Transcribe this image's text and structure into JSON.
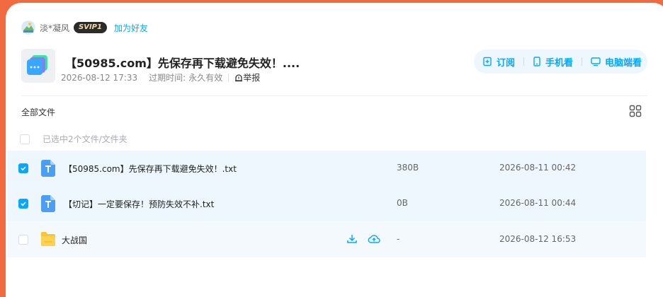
{
  "user": {
    "name": "淡*凝风",
    "vip_badge": "SVIP1",
    "add_friend": "加为好友"
  },
  "share": {
    "title": "【50985.com】先保存再下载避免失效！....",
    "date": "2026-08-12 17:33",
    "expire_label": "过期时间:",
    "expire_value": "永久有效",
    "report": "举报"
  },
  "actions": {
    "subscribe": "订阅",
    "mobile": "手机看",
    "pc": "电脑端看"
  },
  "nav": {
    "all_files": "全部文件"
  },
  "selection": {
    "text": "已选中2个文件/文件夹"
  },
  "files": [
    {
      "name": "【50985.com】先保存再下载避免失效！.txt",
      "size": "380B",
      "date": "2026-08-11 00:42",
      "type": "txt",
      "checked": true
    },
    {
      "name": "【切记】一定要保存！预防失效不补.txt",
      "size": "0B",
      "date": "2026-08-11 00:44",
      "type": "txt",
      "checked": true
    },
    {
      "name": "大战国",
      "size": "-",
      "date": "2026-08-12 16:53",
      "type": "folder",
      "checked": false
    }
  ],
  "icons": {
    "file_icon": "T",
    "download": "download-icon",
    "save": "cloud-upload-icon"
  },
  "colors": {
    "accent": "#06a7ff",
    "row_highlight": "#eef7fd",
    "frame": "#f26a40"
  }
}
